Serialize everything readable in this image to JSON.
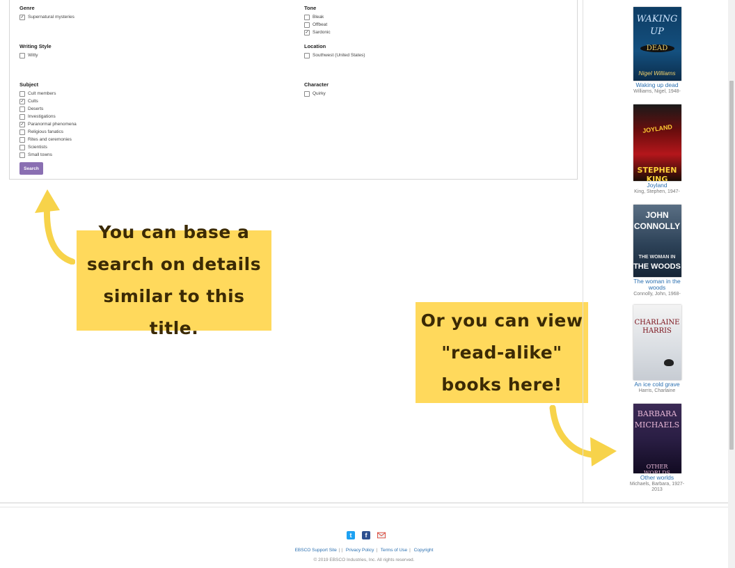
{
  "facets": {
    "genre": {
      "heading": "Genre",
      "options": [
        {
          "label": "Supernatural mysteries",
          "checked": true
        }
      ]
    },
    "tone": {
      "heading": "Tone",
      "options": [
        {
          "label": "Bleak",
          "checked": false
        },
        {
          "label": "Offbeat",
          "checked": false
        },
        {
          "label": "Sardonic",
          "checked": true
        }
      ]
    },
    "writing_style": {
      "heading": "Writing Style",
      "options": [
        {
          "label": "Witty",
          "checked": false
        }
      ]
    },
    "location": {
      "heading": "Location",
      "options": [
        {
          "label": "Southwest (United States)",
          "checked": false
        }
      ]
    },
    "subject": {
      "heading": "Subject",
      "options": [
        {
          "label": "Cult members",
          "checked": false
        },
        {
          "label": "Cults",
          "checked": true
        },
        {
          "label": "Deserts",
          "checked": false
        },
        {
          "label": "Investigations",
          "checked": false
        },
        {
          "label": "Paranormal phenomena",
          "checked": true
        },
        {
          "label": "Religious fanatics",
          "checked": false
        },
        {
          "label": "Rites and ceremonies",
          "checked": false
        },
        {
          "label": "Scientists",
          "checked": false
        },
        {
          "label": "Small towns",
          "checked": false
        }
      ]
    },
    "character": {
      "heading": "Character",
      "options": [
        {
          "label": "Quirky",
          "checked": false
        }
      ]
    }
  },
  "search_button": "Search",
  "callouts": {
    "left": [
      "You can base a",
      "search on details",
      "similar to this title."
    ],
    "right": [
      "Or you can view",
      "\"read-alike\"",
      "books here!"
    ]
  },
  "colors": {
    "callout": "#ffd95c",
    "arrow": "#f7d34a",
    "button": "#8a6fb2",
    "link": "#2a6fb0"
  },
  "readalikes": [
    {
      "title": "Waking up dead",
      "author": "Williams, Nigel, 1948-",
      "cover_text": [
        "WAKING",
        "UP",
        "DEAD",
        "Nigel Williams"
      ]
    },
    {
      "title": "Joyland",
      "author": "King, Stephen, 1947-",
      "cover_text": [
        "JOYLAND",
        "STEPHEN KING"
      ]
    },
    {
      "title": "The woman in the woods",
      "author": "Connolly, John, 1968-",
      "cover_text": [
        "JOHN",
        "CONNOLLY",
        "THE WOMAN IN",
        "THE WOODS"
      ]
    },
    {
      "title": "An ice cold grave",
      "author": "Harris, Charlaine",
      "cover_text": [
        "CHARLAINE",
        "HARRIS"
      ]
    },
    {
      "title": "Other worlds",
      "author": "Michaels, Barbara, 1927-2013",
      "cover_text": [
        "BARBARA",
        "MICHAELS",
        "OTHER WORLDS"
      ]
    }
  ],
  "footer": {
    "icons": [
      "twitter-icon",
      "facebook-icon",
      "email-icon"
    ],
    "links": [
      "EBSCO Support Site",
      "Privacy Policy",
      "Terms of Use",
      "Copyright"
    ],
    "copyright": "© 2019 EBSCO Industries, Inc. All rights reserved."
  }
}
